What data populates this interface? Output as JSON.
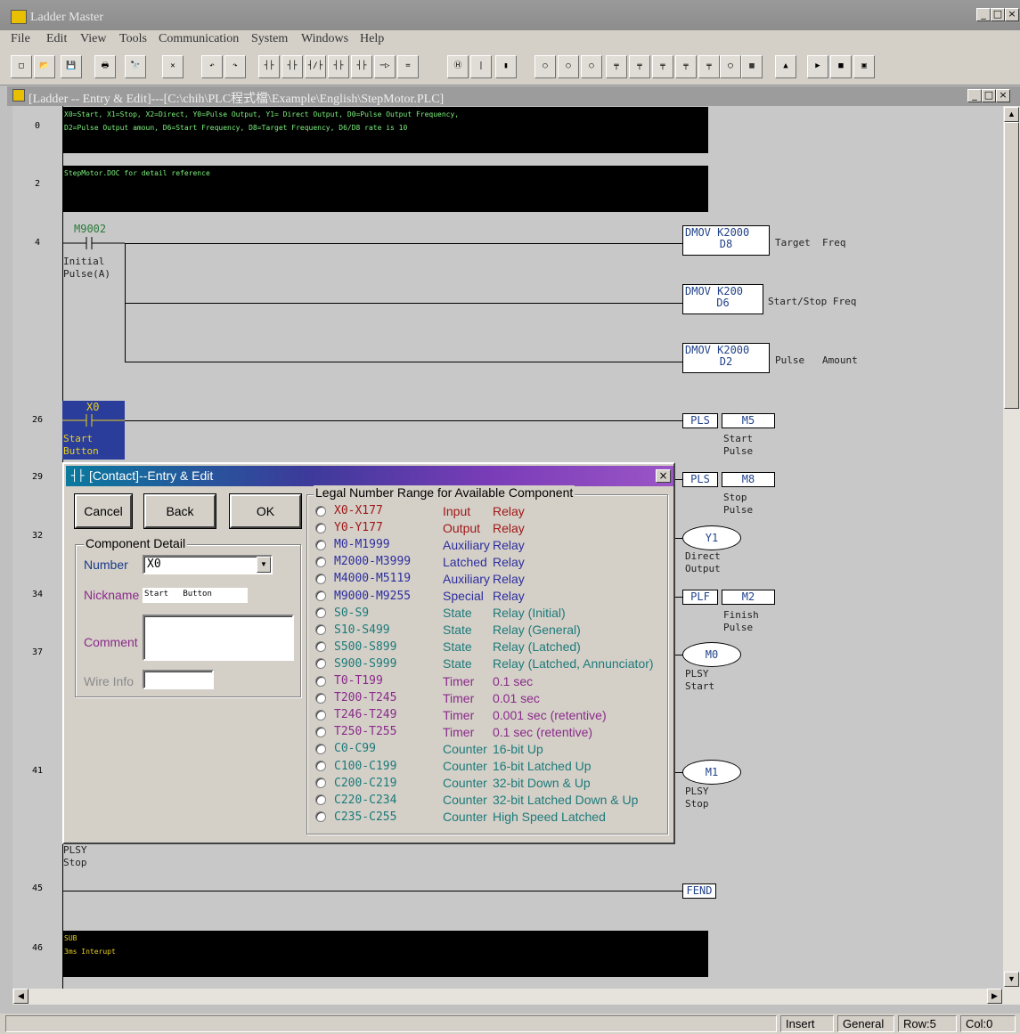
{
  "app": {
    "title": "Ladder Master",
    "window_controls": [
      "_",
      "□",
      "×"
    ]
  },
  "menu": [
    "File",
    "Edit",
    "View",
    "Tools",
    "Communication",
    "System",
    "Windows",
    "Help"
  ],
  "toolbar": {
    "buttons": [
      "new",
      "open",
      "save",
      "print",
      "find",
      "delete",
      "undo",
      "redo",
      "s-S",
      "A",
      "B",
      "s-U",
      "s-D",
      "T",
      "=",
      "H",
      "V",
      "s-V",
      "O",
      "T",
      "C",
      "S",
      "R",
      "U",
      "D",
      "F",
      "comment",
      "IDXO",
      "c-D",
      "c-R",
      "c-T",
      "c-M"
    ]
  },
  "document": {
    "title": "[Ladder -- Entry & Edit]---[C:\\chih\\PLC程式檔\\Example\\English\\StepMotor.PLC]"
  },
  "ladder": {
    "comment0_line1": "X0=Start, X1=Stop, X2=Direct, Y0=Pulse Output, Y1= Direct Output, D0=Pulse Output Frequency,",
    "comment0_line2": "D2=Pulse Output amoun, D6=Start Frequency, D8=Target Frequency, D6/D8 rate is 10",
    "comment2": "StepMotor.DOC for detail reference",
    "rung_numbers": [
      "0",
      "2",
      "4",
      "26",
      "29",
      "32",
      "34",
      "37",
      "41",
      "45",
      "46"
    ],
    "contact_m9002": "M9002",
    "contact_m9002_nick1": "Initial",
    "contact_m9002_nick2": "Pulse(A)",
    "dmov1_line1": "DMOV K2000",
    "dmov1_line2": "D8",
    "dmov1_comment": "Target  Freq",
    "dmov2_line1": "DMOV K200",
    "dmov2_line2": "D6",
    "dmov2_comment": "Start/Stop Freq",
    "dmov3_line1": "DMOV K2000",
    "dmov3_line2": "D2",
    "dmov3_comment": "Pulse   Amount",
    "contact_x0": "X0",
    "contact_x0_nick1": "Start",
    "contact_x0_nick2": "Button",
    "pls1_op": "PLS",
    "pls1_dev": "M5",
    "pls1_c1": "Start",
    "pls1_c2": "Pulse",
    "pls2_op": "PLS",
    "pls2_dev": "M8",
    "pls2_c1": "Stop",
    "pls2_c2": "Pulse",
    "coil_y1": "Y1",
    "coil_y1_c1": "Direct",
    "coil_y1_c2": "Output",
    "plf_op": "PLF",
    "plf_dev": "M2",
    "plf_c1": "Finish",
    "plf_c2": "Pulse",
    "coil_m0": "M0",
    "coil_m0_c1": "PLSY",
    "coil_m0_c2": "Start",
    "coil_m1": "M1",
    "coil_m1_c1": "PLSY",
    "coil_m1_c2": "Stop",
    "left_plsy1": "PLSY",
    "left_plsy2": "Stop",
    "fend": "FEND",
    "sub_line1": "SUB",
    "sub_line2": "3ms Interupt"
  },
  "dialog": {
    "title": "[Contact]--Entry & Edit",
    "close": "×",
    "cancel": "Cancel",
    "back": "Back",
    "ok": "OK",
    "detail_group": "Component Detail",
    "number_label": "Number",
    "number_value": "X0",
    "nickname_label": "Nickname",
    "nickname_value": "Start   Button",
    "comment_label": "Comment",
    "comment_value": "",
    "wire_label": "Wire Info",
    "wire_value": "",
    "range_group": "Legal Number Range for Available Component",
    "ranges": [
      {
        "range": "X0-X177",
        "type": "Input",
        "desc": "Relay",
        "color": "#a01818"
      },
      {
        "range": "Y0-Y177",
        "type": "Output",
        "desc": "Relay",
        "color": "#a01818"
      },
      {
        "range": "M0-M1999",
        "type": "Auxiliary",
        "desc": "Relay",
        "color": "#2e2e9e"
      },
      {
        "range": "M2000-M3999",
        "type": "Latched",
        "desc": "Relay",
        "color": "#2e2e9e"
      },
      {
        "range": "M4000-M5119",
        "type": "Auxiliary",
        "desc": "Relay",
        "color": "#2e2e9e"
      },
      {
        "range": "M9000-M9255",
        "type": "Special",
        "desc": "Relay",
        "color": "#2e2e9e"
      },
      {
        "range": "S0-S9",
        "type": "State",
        "desc": "Relay (Initial)",
        "color": "#1d7a7a"
      },
      {
        "range": "S10-S499",
        "type": "State",
        "desc": "Relay (General)",
        "color": "#1d7a7a"
      },
      {
        "range": "S500-S899",
        "type": "State",
        "desc": "Relay (Latched)",
        "color": "#1d7a7a"
      },
      {
        "range": "S900-S999",
        "type": "State",
        "desc": "Relay (Latched, Annunciator)",
        "color": "#1d7a7a"
      },
      {
        "range": "T0-T199",
        "type": "Timer",
        "desc": "0.1 sec",
        "color": "#8a2a8a"
      },
      {
        "range": "T200-T245",
        "type": "Timer",
        "desc": "0.01 sec",
        "color": "#8a2a8a"
      },
      {
        "range": "T246-T249",
        "type": "Timer",
        "desc": "0.001 sec (retentive)",
        "color": "#8a2a8a"
      },
      {
        "range": "T250-T255",
        "type": "Timer",
        "desc": "0.1 sec (retentive)",
        "color": "#8a2a8a"
      },
      {
        "range": "C0-C99",
        "type": "Counter",
        "desc": "16-bit Up",
        "color": "#1d7a7a"
      },
      {
        "range": "C100-C199",
        "type": "Counter",
        "desc": "16-bit Latched Up",
        "color": "#1d7a7a"
      },
      {
        "range": "C200-C219",
        "type": "Counter",
        "desc": "32-bit Down & Up",
        "color": "#1d7a7a"
      },
      {
        "range": "C220-C234",
        "type": "Counter",
        "desc": "32-bit Latched Down & Up",
        "color": "#1d7a7a"
      },
      {
        "range": "C235-C255",
        "type": "Counter",
        "desc": "High Speed Latched",
        "color": "#1d7a7a"
      }
    ]
  },
  "status": {
    "mode": "Insert",
    "type": "General",
    "row": "Row:5",
    "col": "Col:0"
  },
  "colors": {
    "comment_text": "#7cf07c",
    "instruction_text": "#22438a",
    "selection": "#2a3d9a",
    "nickname_text": "#e8d020"
  }
}
